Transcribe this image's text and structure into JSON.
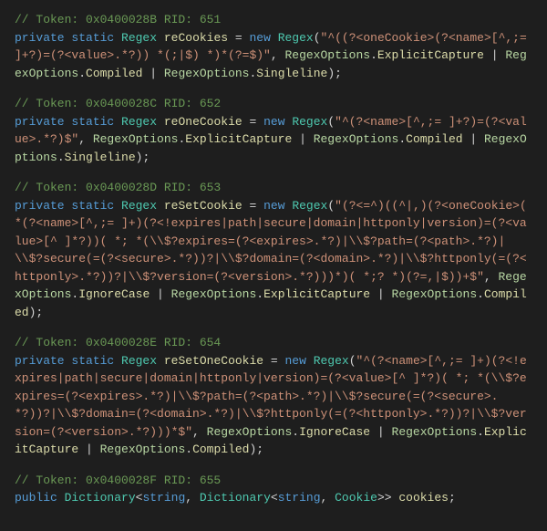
{
  "blocks": [
    {
      "comment": "// Token: 0x0400028B RID: 651",
      "modifiers": "private static",
      "type": "Regex",
      "fieldName": "reCookies",
      "assign": " = ",
      "newKw": "new",
      "ctorType": "Regex",
      "openParen": "(",
      "stringLit": "\"^((?<oneCookie>(?<name>[^,;= ]+?)=(?<value>.*?)) *(;|$) *)*(?=$)\"",
      "sep": ", ",
      "enumType": "RegexOptions",
      "member1": "ExplicitCapture",
      "pipe": " | ",
      "member2": "Compiled",
      "member3": "Singleline",
      "close": ");"
    },
    {
      "comment": "// Token: 0x0400028C RID: 652",
      "modifiers": "private static",
      "type": "Regex",
      "fieldName": "reOneCookie",
      "assign": " = ",
      "newKw": "new",
      "ctorType": "Regex",
      "openParen": "(",
      "stringLit": "\"^(?<name>[^,;= ]+?)=(?<value>.*?)$\"",
      "sep": ", ",
      "enumType": "RegexOptions",
      "member1": "ExplicitCapture",
      "pipe": " | ",
      "member2": "Compiled",
      "member3": "Singleline",
      "close": ");"
    },
    {
      "comment": "// Token: 0x0400028D RID: 653",
      "modifiers": "private static",
      "type": "Regex",
      "fieldName": "reSetCookie",
      "assign": " = ",
      "newKw": "new",
      "ctorType": "Regex",
      "openParen": "(",
      "stringLit": "\"(?<=^)((^|,)(?<oneCookie>( *(?<name>[^,;= ]+)(?<!expires|path|secure|domain|httponly|version)=(?<value>[^ ]*?))( *; *(\\\\$?expires=(?<expires>.*?)|\\\\$?path=(?<path>.*?)|\\\\$?secure(=(?<secure>.*?))?|\\\\$?domain=(?<domain>.*?)|\\\\$?httponly(=(?<httponly>.*?))?|\\\\$?version=(?<version>.*?)))*)( *;? *)(?=,|$))+$\"",
      "sep": ", ",
      "enumType": "RegexOptions",
      "member1": "IgnoreCase",
      "pipe": " | ",
      "member2": "ExplicitCapture",
      "member3": "Compiled",
      "close": ");"
    },
    {
      "comment": "// Token: 0x0400028E RID: 654",
      "modifiers": "private static",
      "type": "Regex",
      "fieldName": "reSetOneCookie",
      "assign": " = ",
      "newKw": "new",
      "ctorType": "Regex",
      "openParen": "(",
      "stringLit": "\"^(?<name>[^,;= ]+)(?<!expires|path|secure|domain|httponly|version)=(?<value>[^ ]*?)( *; *(\\\\$?expires=(?<expires>.*?)|\\\\$?path=(?<path>.*?)|\\\\$?secure(=(?<secure>.*?))?|\\\\$?domain=(?<domain>.*?)|\\\\$?httponly(=(?<httponly>.*?))?|\\\\$?version=(?<version>.*?)))*$\"",
      "sep": ", ",
      "enumType": "RegexOptions",
      "member1": "IgnoreCase",
      "pipe": " | ",
      "member2": "ExplicitCapture",
      "member3": "Compiled",
      "close": ");"
    }
  ],
  "finalBlock": {
    "comment": "// Token: 0x0400028F RID: 655",
    "modifier": "public",
    "type1": "Dictionary",
    "lt1": "<",
    "strType": "string",
    "comma": ", ",
    "type2": "Dictionary",
    "lt2": "<",
    "cookieType": "Cookie",
    "gt": ">>",
    "fieldName": " cookies",
    "semi": ";"
  }
}
